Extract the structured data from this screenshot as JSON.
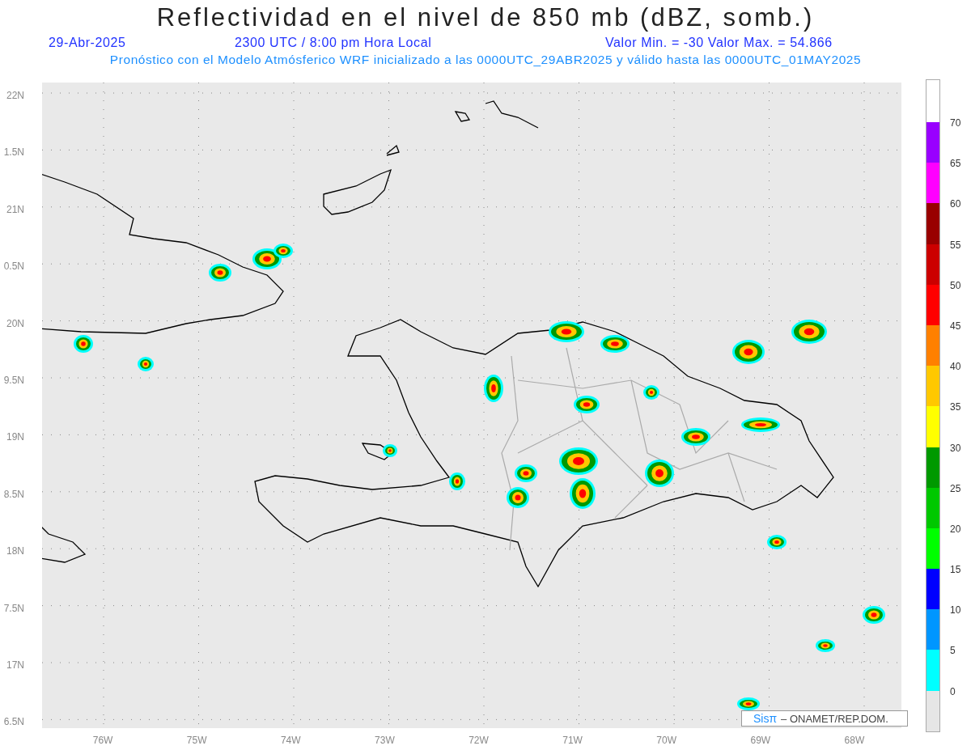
{
  "title": "Reflectividad en el nivel de 850 mb (dBZ, somb.)",
  "subtitle": {
    "date": "29-Abr-2025",
    "time": "2300 UTC / 8:00 pm Hora Local",
    "range": "Valor Min. = -30  Valor Max. = 54.866"
  },
  "description": "Pronóstico con el Modelo Atmósferico WRF inicializado a las 0000UTC_29ABR2025 y válido hasta las  0000UTC_01MAY2025",
  "map": {
    "lat_labels": [
      "22N",
      "1.5N",
      "21N",
      "0.5N",
      "20N",
      "9.5N",
      "19N",
      "8.5N",
      "18N",
      "7.5N",
      "17N",
      "6.5N"
    ],
    "lon_labels": [
      "76W",
      "75W",
      "74W",
      "73W",
      "72W",
      "71W",
      "70W",
      "69W",
      "68W"
    ],
    "credit": {
      "logo": "Sisπ",
      "text": "– ONAMET/REP.DOM."
    }
  },
  "colorbar": {
    "labels": [
      "70",
      "65",
      "60",
      "55",
      "50",
      "45",
      "40",
      "35",
      "30",
      "25",
      "20",
      "15",
      "10",
      "5",
      "0"
    ],
    "segments": [
      {
        "color": "#9900ff"
      },
      {
        "color": "#ff00ff"
      },
      {
        "color": "#990000"
      },
      {
        "color": "#cc0000"
      },
      {
        "color": "#ff0000"
      },
      {
        "color": "#ff8000"
      },
      {
        "color": "#ffc800"
      },
      {
        "color": "#ffff00"
      },
      {
        "color": "#009900"
      },
      {
        "color": "#00c800"
      },
      {
        "color": "#00ff00"
      },
      {
        "color": "#0000ff"
      },
      {
        "color": "#0096ff"
      },
      {
        "color": "#00ffff"
      }
    ]
  }
}
